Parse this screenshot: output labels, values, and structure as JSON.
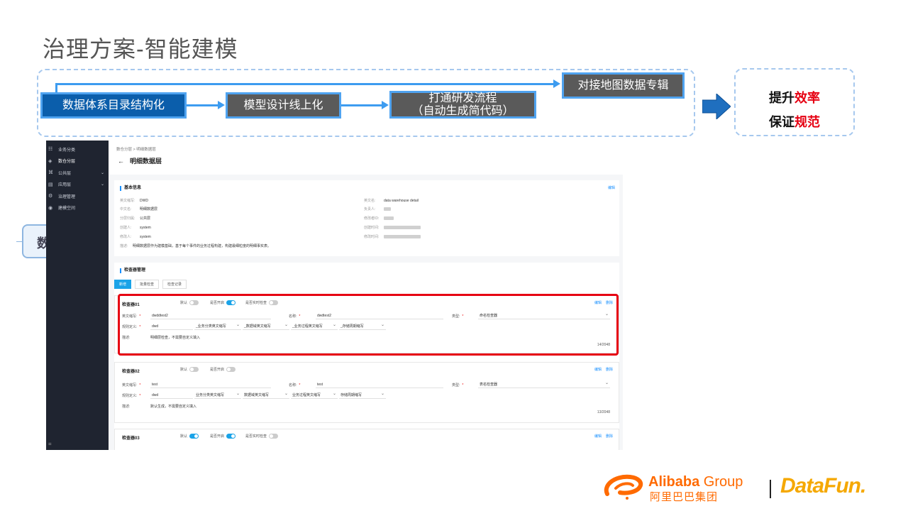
{
  "slide": {
    "title": "治理方案-智能建模",
    "flow": {
      "step1": "数据体系目录结构化",
      "step2": "模型设计线上化",
      "step3_line1": "打通研发流程",
      "step3_line2": "（自动生成简代码）",
      "step4": "对接地图数据专辑"
    },
    "result": {
      "line1_prefix": "提升",
      "line1_highlight": "效率",
      "line2_prefix": "保证",
      "line2_highlight": "规范"
    },
    "overlap_text": "数"
  },
  "sidebar": {
    "items": [
      {
        "icon": "☷",
        "label": "业务分类"
      },
      {
        "icon": "◈",
        "label": "数仓分层"
      },
      {
        "icon": "⌘",
        "label": "公共层"
      },
      {
        "icon": "▤",
        "label": "应用层"
      },
      {
        "icon": "⚙",
        "label": "治理管理"
      },
      {
        "icon": "◉",
        "label": "建模空间"
      }
    ],
    "bottom": "="
  },
  "page": {
    "breadcrumb": "数仓分层 > 明细数据层",
    "back": "←",
    "title": "明细数据层"
  },
  "basic_info": {
    "title": "基本信息",
    "edit": "编辑",
    "left": [
      {
        "k": "英文缩写:",
        "v": "DWD"
      },
      {
        "k": "中文名:",
        "v": "明细数据层"
      },
      {
        "k": "分层归属:",
        "v": "公共层"
      },
      {
        "k": "创建人:",
        "v": "system"
      },
      {
        "k": "修改人:",
        "v": "system"
      },
      {
        "k": "描述:",
        "v": "明细数据层作为建模基础，基于每个事件的业务过程构建，构建最细粒度的明细事实表。"
      }
    ],
    "right": [
      {
        "k": "英文名:",
        "v": "data warehouse detail"
      },
      {
        "k": "负责人:",
        "v": ""
      },
      {
        "k": "修改者ID:",
        "v": ""
      },
      {
        "k": "创建时间:",
        "v": ""
      },
      {
        "k": "修改时间:",
        "v": ""
      }
    ]
  },
  "checker_section": {
    "title": "检查器管理",
    "tabs": [
      "新增",
      "批量检查",
      "检查记录"
    ]
  },
  "checkers": [
    {
      "title": "检查器01",
      "sw1": "默认",
      "sw2": "是否开启",
      "sw3": "是否实时检查",
      "ops": [
        "编辑",
        "删除"
      ],
      "en_label": "英文缩写:",
      "en_val": "dwddtest2",
      "name_label": "名称:",
      "name_val": "dwdtest2",
      "type_label": "类型:",
      "type_val": "命名检查器",
      "rule_label": "规则定义:",
      "rule_val": "dwd",
      "sel1": "_业务分类英文缩写",
      "sel2": "_数据域英文缩写",
      "sel3": "_业务过程英文缩写",
      "sel4": "_存储周期缩写",
      "desc_label": "描述:",
      "desc_val": "明细层检查，不需要自定义填入",
      "counter": "14/2048"
    },
    {
      "title": "检查器02",
      "sw1": "默认",
      "sw2": "是否开启",
      "sw3": "",
      "ops": [
        "编辑",
        "删除"
      ],
      "en_label": "英文缩写:",
      "en_val": "test",
      "name_label": "名称:",
      "name_val": "test",
      "type_label": "类型:",
      "type_val": "表名检查器",
      "rule_label": "规则定义:",
      "rule_val": "dwd",
      "sel1": "业务分类英文缩写",
      "sel2": "数据域英文缩写",
      "sel3": "业务过程英文缩写",
      "sel4": "存储周期缩写",
      "desc_label": "描述:",
      "desc_val": "默认生成，不需要自定义填入",
      "counter": "13/2048"
    },
    {
      "title": "检查器03",
      "sw1": "默认",
      "sw2": "是否开启",
      "sw3": "是否实时检查",
      "ops": [
        "编辑",
        "删除"
      ]
    }
  ],
  "logos": {
    "alibaba_en": "Alibaba",
    "alibaba_group": " Group",
    "alibaba_cn": "阿里巴巴集团",
    "datafun": "DataFun."
  },
  "colors": {
    "step_blue": "#0b5eab",
    "step_gray": "#5a5a5a",
    "accent": "#3d9cf0",
    "highlight_red": "#e60012",
    "alibaba_orange": "#ff6a00",
    "datafun_yellow": "#f5a800"
  }
}
